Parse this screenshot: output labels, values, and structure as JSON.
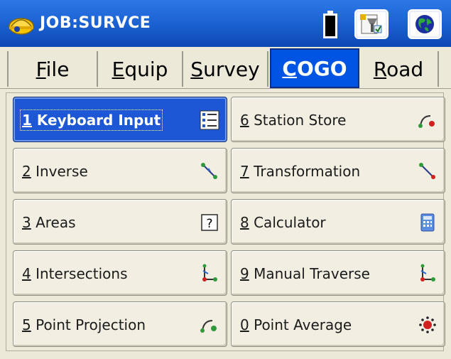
{
  "titlebar": {
    "title": "JOB:SURVCE",
    "logo_icon": "hardhat-logo-icon",
    "battery_icon": "battery-icon",
    "config_icon": "config-tool-icon",
    "globe_icon": "globe-icon"
  },
  "tabs": [
    {
      "key": "F",
      "rest": "ile",
      "full": "File",
      "active": false
    },
    {
      "key": "E",
      "rest": "quip",
      "full": "Equip",
      "active": false
    },
    {
      "key": "S",
      "rest": "urvey",
      "full": "Survey",
      "active": false
    },
    {
      "key": "C",
      "rest": "OGO",
      "full": "COGO",
      "active": true
    },
    {
      "key": "R",
      "rest": "oad",
      "full": "Road",
      "active": false
    }
  ],
  "buttons": [
    {
      "num": "1",
      "label": " Keyboard Input",
      "icon": "list-icon"
    },
    {
      "num": "2",
      "label": " Inverse",
      "icon": "inverse-line-icon"
    },
    {
      "num": "3",
      "label": " Areas",
      "icon": "question-box-icon"
    },
    {
      "num": "4",
      "label": " Intersections",
      "icon": "intersection-icon"
    },
    {
      "num": "5",
      "label": " Point Projection",
      "icon": "arc-point-icon"
    },
    {
      "num": "6",
      "label": " Station Store",
      "icon": "arc-red-point-icon"
    },
    {
      "num": "7",
      "label": " Transformation",
      "icon": "transform-line-icon"
    },
    {
      "num": "8",
      "label": " Calculator",
      "icon": "calculator-icon"
    },
    {
      "num": "9",
      "label": " Manual Traverse",
      "icon": "traverse-icon"
    },
    {
      "num": "0",
      "label": " Point Average",
      "icon": "point-average-icon"
    }
  ],
  "colors": {
    "titlebar": "#1a5fd0",
    "active_tab": "#0054e3",
    "active_button": "#1d57d6",
    "background": "#ece9d8"
  }
}
